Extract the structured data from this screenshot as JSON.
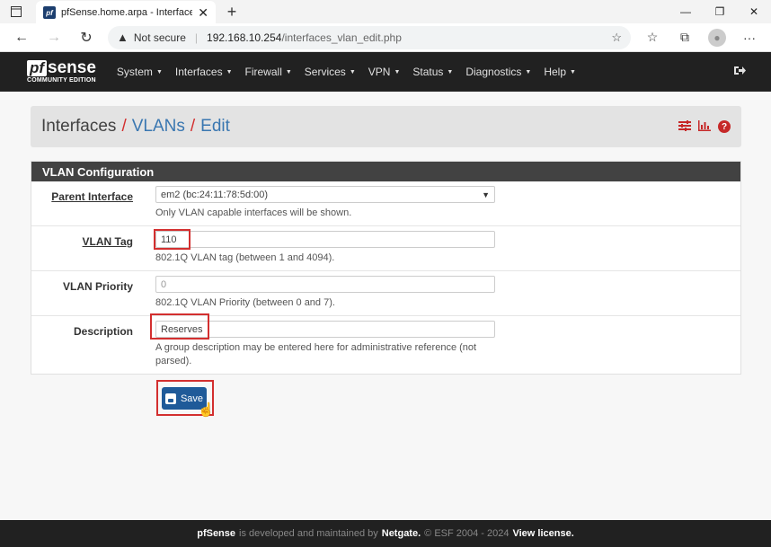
{
  "browser": {
    "tab_title": "pfSense.home.arpa - Interfaces: VLANs: Edit",
    "favicon_text": "pf",
    "not_secure": "Not secure",
    "url_host": "192.168.10.254",
    "url_path": "/interfaces_vlan_edit.php"
  },
  "nav": {
    "logo_pf": "pf",
    "logo_sense": "sense",
    "logo_edition": "COMMUNITY EDITION",
    "menu": [
      "System",
      "Interfaces",
      "Firewall",
      "Services",
      "VPN",
      "Status",
      "Diagnostics",
      "Help"
    ]
  },
  "header": {
    "crumb1": "Interfaces",
    "crumb2": "VLANs",
    "crumb3": "Edit",
    "sep": "/"
  },
  "panel": {
    "title": "VLAN Configuration",
    "fields": {
      "parent": {
        "label": "Parent Interface",
        "value": "em2 (bc:24:11:78:5d:00)",
        "help": "Only VLAN capable interfaces will be shown."
      },
      "tag": {
        "label": "VLAN Tag",
        "value": "110",
        "help": "802.1Q VLAN tag (between 1 and 4094)."
      },
      "priority": {
        "label": "VLAN Priority",
        "placeholder": "0",
        "help": "802.1Q VLAN Priority (between 0 and 7)."
      },
      "description": {
        "label": "Description",
        "value": "Reserves",
        "help": "A group description may be entered here for administrative reference (not parsed)."
      }
    },
    "save_label": "Save"
  },
  "footer": {
    "brand": "pfSense",
    "text1": "is developed and maintained by",
    "company": "Netgate.",
    "text2": "© ESF 2004 - 2024",
    "license": "View license."
  },
  "colors": {
    "navbar": "#212121",
    "panel_heading": "#424242",
    "link": "#3a77b1",
    "accent_red": "#d32f2f",
    "save_button": "#1f5a99"
  }
}
